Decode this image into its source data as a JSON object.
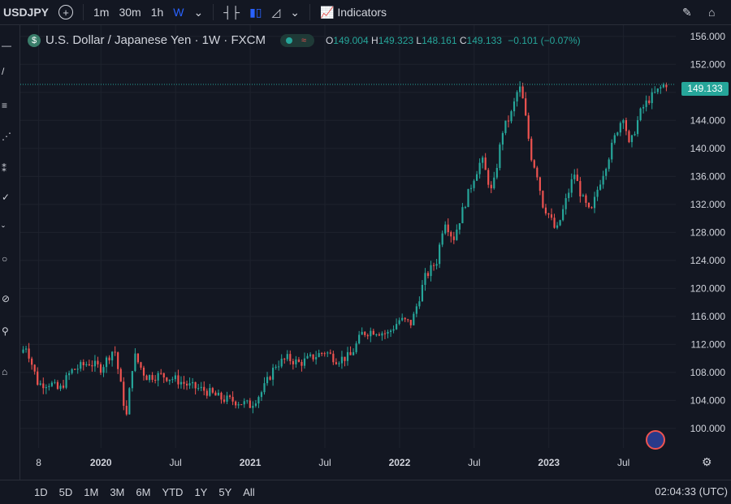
{
  "toolbar": {
    "symbol": "USDJPY",
    "intervals": [
      "1m",
      "30m",
      "1h",
      "W"
    ],
    "active_interval": "W",
    "indicators_label": "Indicators"
  },
  "legend": {
    "title": "U.S. Dollar / Japanese Yen · 1W · FXCM",
    "o_label": "O",
    "o": "149.004",
    "h_label": "H",
    "h": "149.323",
    "l_label": "L",
    "l": "148.161",
    "c_label": "C",
    "c": "149.133",
    "change": "−0.101 (−0.07%)"
  },
  "current_price": "149.133",
  "range_buttons": [
    "1D",
    "5D",
    "1M",
    "3M",
    "6M",
    "YTD",
    "1Y",
    "5Y",
    "All"
  ],
  "clock": "02:04:33 (UTC)",
  "colors": {
    "up": "#26a69a",
    "down": "#ef5350",
    "bg": "#131722",
    "grid": "#1e222d",
    "text": "#d1d4dc"
  },
  "chart_data": {
    "type": "candlestick",
    "title": "U.S. Dollar / Japanese Yen · 1W · FXCM",
    "y_ticks": [
      "156.000",
      "152.000",
      "148.000",
      "144.000",
      "140.000",
      "136.000",
      "132.000",
      "128.000",
      "124.000",
      "120.000",
      "116.000",
      "112.000",
      "108.000",
      "104.000",
      "100.000"
    ],
    "y_tick_values": [
      156,
      152,
      148,
      144,
      140,
      136,
      132,
      128,
      124,
      120,
      116,
      112,
      108,
      104,
      100
    ],
    "x_ticks": [
      "8",
      "2020",
      "Jul",
      "2021",
      "Jul",
      "2022",
      "Jul",
      "2023",
      "Jul"
    ],
    "x_tick_times": [
      2019.583,
      2020.0,
      2020.5,
      2021.0,
      2021.5,
      2022.0,
      2022.5,
      2023.0,
      2023.5
    ],
    "ylim": [
      97.2,
      157.6
    ],
    "xlim": [
      2019.46,
      2023.85
    ],
    "last_price": 149.133,
    "anchor_path": [
      [
        2019.46,
        110.8
      ],
      [
        2019.5,
        111.8
      ],
      [
        2019.54,
        109.0
      ],
      [
        2019.58,
        106.3
      ],
      [
        2019.66,
        106.5
      ],
      [
        2019.72,
        105.4
      ],
      [
        2019.8,
        108.2
      ],
      [
        2019.92,
        109.4
      ],
      [
        2020.0,
        108.6
      ],
      [
        2020.09,
        111.5
      ],
      [
        2020.17,
        101.5
      ],
      [
        2020.22,
        110.6
      ],
      [
        2020.3,
        107.4
      ],
      [
        2020.4,
        107.6
      ],
      [
        2020.5,
        107.0
      ],
      [
        2020.6,
        106.0
      ],
      [
        2020.7,
        105.4
      ],
      [
        2020.8,
        104.3
      ],
      [
        2020.92,
        103.8
      ],
      [
        2021.0,
        103.3
      ],
      [
        2021.08,
        105.3
      ],
      [
        2021.17,
        109.1
      ],
      [
        2021.25,
        110.0
      ],
      [
        2021.33,
        109.3
      ],
      [
        2021.42,
        110.2
      ],
      [
        2021.5,
        111.0
      ],
      [
        2021.58,
        109.8
      ],
      [
        2021.67,
        110.3
      ],
      [
        2021.75,
        113.6
      ],
      [
        2021.83,
        114.0
      ],
      [
        2021.92,
        113.5
      ],
      [
        2022.0,
        115.5
      ],
      [
        2022.08,
        115.0
      ],
      [
        2022.17,
        121.5
      ],
      [
        2022.25,
        124.0
      ],
      [
        2022.3,
        130.0
      ],
      [
        2022.36,
        127.0
      ],
      [
        2022.42,
        131.0
      ],
      [
        2022.5,
        136.0
      ],
      [
        2022.55,
        138.5
      ],
      [
        2022.62,
        133.5
      ],
      [
        2022.69,
        142.5
      ],
      [
        2022.75,
        145.0
      ],
      [
        2022.8,
        149.0
      ],
      [
        2022.83,
        146.5
      ],
      [
        2022.88,
        139.0
      ],
      [
        2022.92,
        136.5
      ],
      [
        2022.96,
        132.0
      ],
      [
        2023.0,
        130.5
      ],
      [
        2023.05,
        128.0
      ],
      [
        2023.1,
        131.5
      ],
      [
        2023.17,
        136.5
      ],
      [
        2023.22,
        133.0
      ],
      [
        2023.28,
        130.5
      ],
      [
        2023.33,
        134.5
      ],
      [
        2023.4,
        138.8
      ],
      [
        2023.46,
        142.8
      ],
      [
        2023.5,
        144.8
      ],
      [
        2023.54,
        140.0
      ],
      [
        2023.58,
        143.0
      ],
      [
        2023.62,
        145.5
      ],
      [
        2023.67,
        147.0
      ],
      [
        2023.72,
        148.0
      ],
      [
        2023.78,
        149.3
      ],
      [
        2023.8,
        149.133
      ]
    ]
  }
}
